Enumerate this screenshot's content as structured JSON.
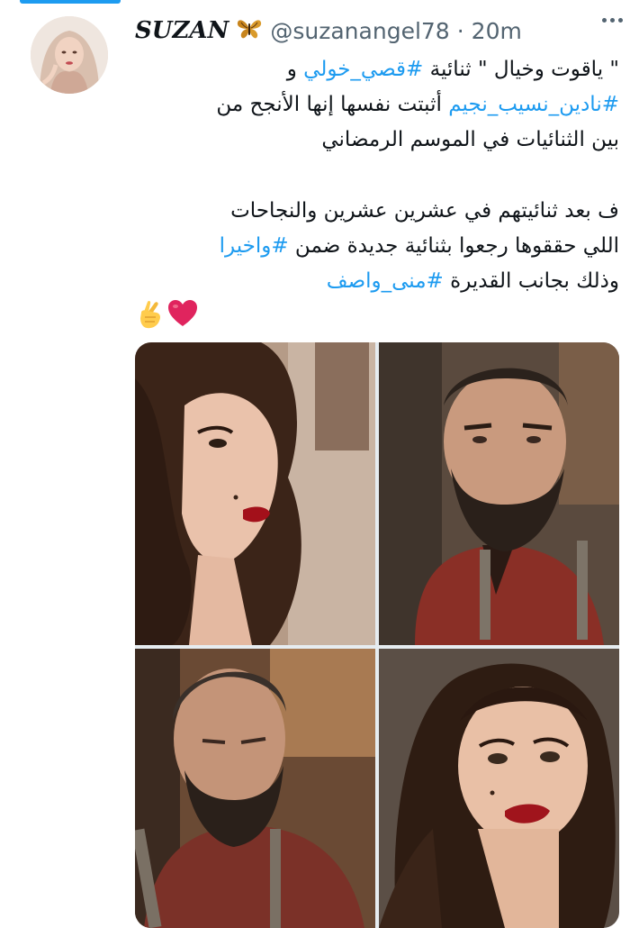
{
  "author": {
    "display_name": "SUZAN",
    "badge_icon": "butterfly-icon",
    "handle": "@suzanangel78",
    "separator": "·",
    "time": "20m"
  },
  "tweet": {
    "line1_a": "\" ياقوت وخيال \" ثنائية ",
    "line1_tag": "#قصي_خولي",
    "line1_b": " و",
    "line2_tag": "#نادين_نسيب_نجيم",
    "line2_b": " أثبتت نفسها إنها الأنجح من",
    "line3": "بين الثنائيات في الموسم الرمضاني",
    "line4": "ف بعد ثنائيتهم في عشرين عشرين والنجاحات",
    "line5_a": "اللي حققوها رجعوا بثنائية جديدة ضمن ",
    "line5_tag": "#واخيرا",
    "line6_a": "وذلك بجانب القديرة ",
    "line6_tag": "#منى_واصف",
    "emoji": [
      "heart-icon",
      "fingers-crossed-icon"
    ]
  },
  "colors": {
    "hashtag": "#1d9bf0",
    "text": "#0f1419",
    "secondary": "#536471",
    "heart": "#e0245e"
  }
}
